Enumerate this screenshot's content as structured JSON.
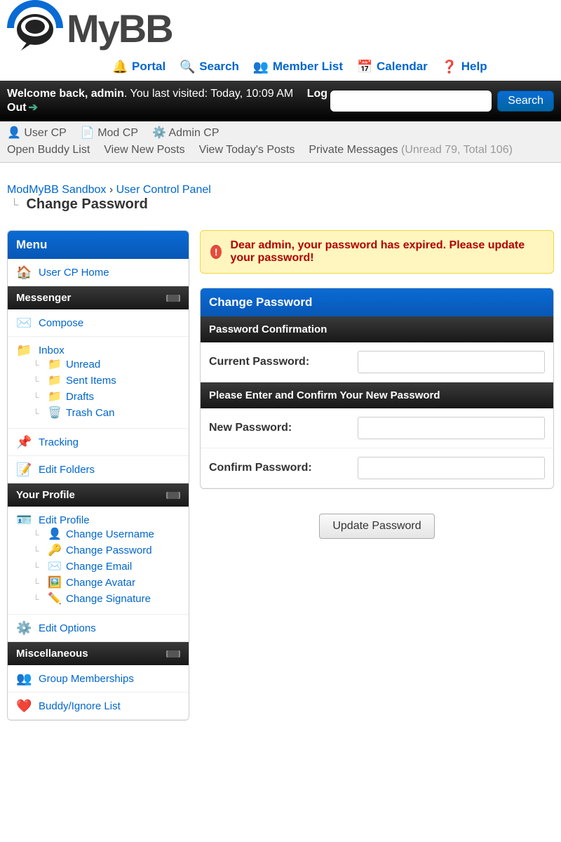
{
  "logo": {
    "text": "MyBB"
  },
  "topNav": {
    "portal": "Portal",
    "search": "Search",
    "memberList": "Member List",
    "calendar": "Calendar",
    "help": "Help"
  },
  "welcome": {
    "prefix": "Welcome back, ",
    "user": "admin",
    "lastVisit": ". You last visited: Today, 10:09 AM",
    "logout": "Log Out",
    "searchBtn": "Search"
  },
  "subNav": {
    "userCP": "User CP",
    "modCP": "Mod CP",
    "adminCP": "Admin CP",
    "buddyList": "Open Buddy List",
    "viewNew": "View New Posts",
    "viewToday": "View Today's Posts",
    "pm": "Private Messages",
    "pmCount": "(Unread 79, Total 106)"
  },
  "breadcrumb": {
    "root": "ModMyBB Sandbox",
    "ucp": "User Control Panel",
    "current": "Change Password"
  },
  "sidebar": {
    "menuTitle": "Menu",
    "userCPHome": "User CP Home",
    "messenger": {
      "title": "Messenger",
      "compose": "Compose",
      "inbox": "Inbox",
      "unread": "Unread",
      "sentItems": "Sent Items",
      "drafts": "Drafts",
      "trash": "Trash Can",
      "tracking": "Tracking",
      "editFolders": "Edit Folders"
    },
    "profile": {
      "title": "Your Profile",
      "editProfile": "Edit Profile",
      "changeUsername": "Change Username",
      "changePassword": "Change Password",
      "changeEmail": "Change Email",
      "changeAvatar": "Change Avatar",
      "changeSignature": "Change Signature",
      "editOptions": "Edit Options"
    },
    "misc": {
      "title": "Miscellaneous",
      "groupMemberships": "Group Memberships",
      "buddyIgnore": "Buddy/Ignore List"
    }
  },
  "content": {
    "alert": "Dear admin, your password has expired. Please update your password!",
    "panelTitle": "Change Password",
    "section1": "Password Confirmation",
    "currentPwdLabel": "Current Password:",
    "section2": "Please Enter and Confirm Your New Password",
    "newPwdLabel": "New Password:",
    "confirmPwdLabel": "Confirm Password:",
    "updateBtn": "Update Password"
  }
}
